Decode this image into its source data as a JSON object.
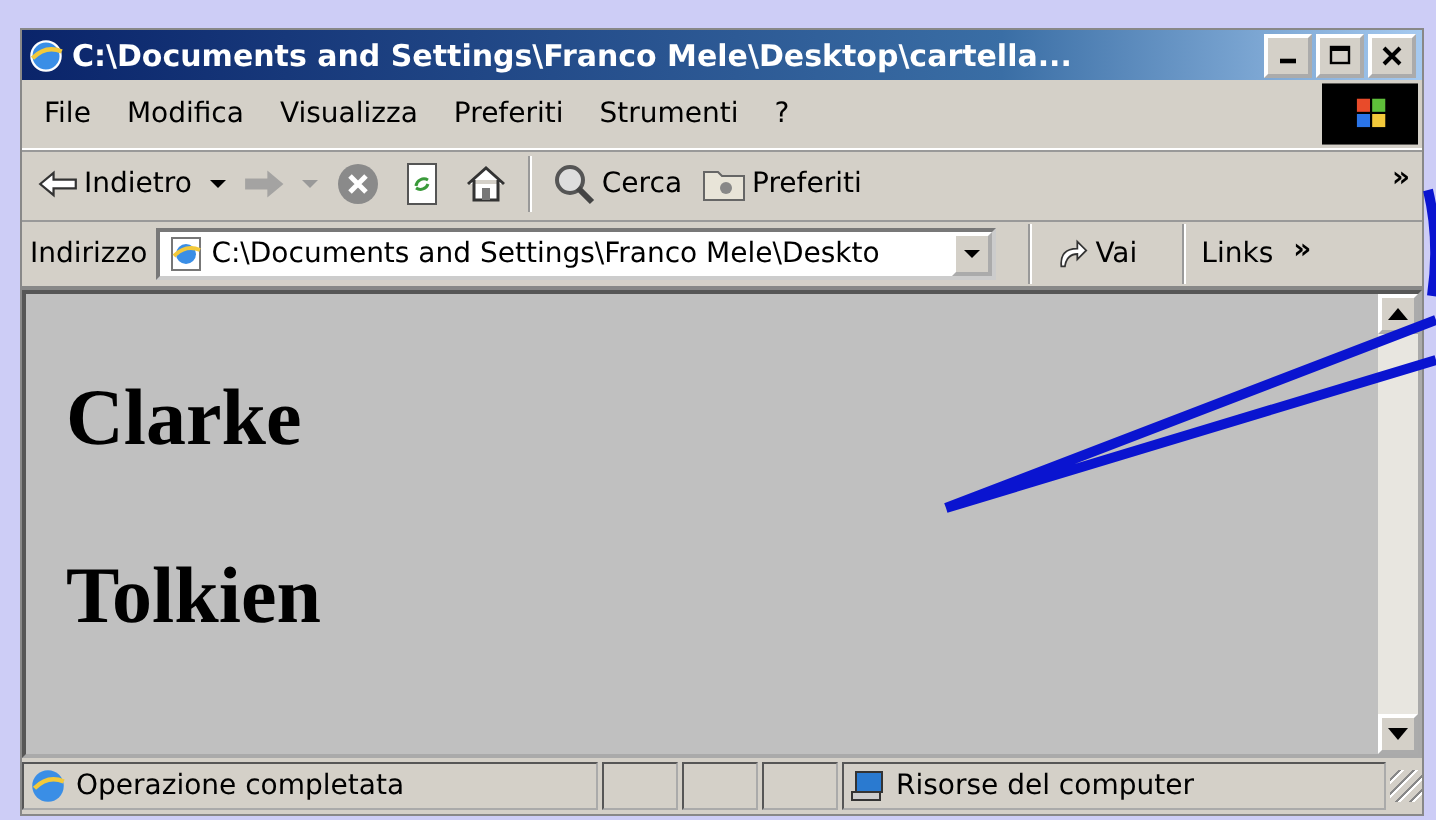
{
  "window": {
    "title": "C:\\Documents and Settings\\Franco Mele\\Desktop\\cartella..."
  },
  "menu": [
    "File",
    "Modifica",
    "Visualizza",
    "Preferiti",
    "Strumenti",
    "?"
  ],
  "toolbar": [
    {
      "kind": "back",
      "label": "Indietro",
      "disabled": false
    },
    {
      "kind": "forward",
      "disabled": true
    },
    {
      "kind": "stop",
      "disabled": false
    },
    {
      "kind": "refresh",
      "disabled": false
    },
    {
      "kind": "home",
      "disabled": false
    },
    {
      "kind": "search",
      "label": "Cerca",
      "disabled": false
    },
    {
      "kind": "favorites",
      "label": "Preferiti",
      "disabled": false
    }
  ],
  "toolbar_more": "»",
  "address_bar": {
    "label": "Indirizzo",
    "value": "C:\\Documents and Settings\\Franco Mele\\Deskto",
    "go": "Vai",
    "links": "Links",
    "more": "»"
  },
  "content": {
    "headings": [
      "Clarke",
      "Tolkien"
    ]
  },
  "status_bar": {
    "message": "Operazione completata",
    "zone": "Risorse del computer"
  }
}
